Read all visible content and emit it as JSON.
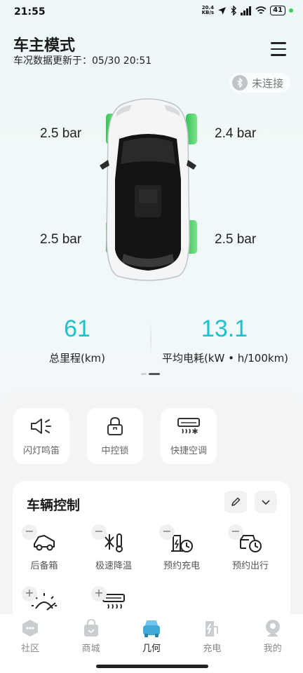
{
  "status": {
    "time": "21:55",
    "speed_value": "20.4",
    "speed_unit": "KB/s",
    "battery": "41"
  },
  "header": {
    "title": "车主模式",
    "update_label": "车况数据更新于：",
    "update_time": "05/30 20:51"
  },
  "connection": {
    "label": "未连接"
  },
  "tyres": {
    "front_left": "2.5 bar",
    "front_right": "2.4 bar",
    "rear_left": "2.5 bar",
    "rear_right": "2.5 bar"
  },
  "stats": {
    "mileage_value": "61",
    "mileage_label": "总里程(km)",
    "consumption_value": "13.1",
    "consumption_label": "平均电耗(kW • h/100km)"
  },
  "quick_actions": [
    {
      "label": "闪灯鸣笛",
      "icon": "horn-flash-icon"
    },
    {
      "label": "中控锁",
      "icon": "lock-icon"
    },
    {
      "label": "快捷空调",
      "icon": "air-conditioner-icon"
    }
  ],
  "vehicle_control": {
    "title": "车辆控制",
    "items": [
      {
        "label": "后备箱",
        "icon": "trunk-icon",
        "badge": "−"
      },
      {
        "label": "极速降温",
        "icon": "rapid-cooling-icon",
        "badge": "−"
      },
      {
        "label": "预约充电",
        "icon": "scheduled-charging-icon",
        "badge": "−"
      },
      {
        "label": "预约出行",
        "icon": "scheduled-trip-icon",
        "badge": "−"
      },
      {
        "label": "",
        "icon": "sunshade-icon",
        "badge": "+"
      },
      {
        "label": "",
        "icon": "heater-icon",
        "badge": "+"
      }
    ]
  },
  "nav": [
    {
      "label": "社区",
      "icon": "community-icon"
    },
    {
      "label": "商城",
      "icon": "shop-icon"
    },
    {
      "label": "几何",
      "icon": "car-icon",
      "active": true
    },
    {
      "label": "充电",
      "icon": "charging-icon"
    },
    {
      "label": "我的",
      "icon": "profile-icon"
    }
  ],
  "colors": {
    "accent": "#1ec2c9",
    "tyre_ok": "#4cd964"
  }
}
